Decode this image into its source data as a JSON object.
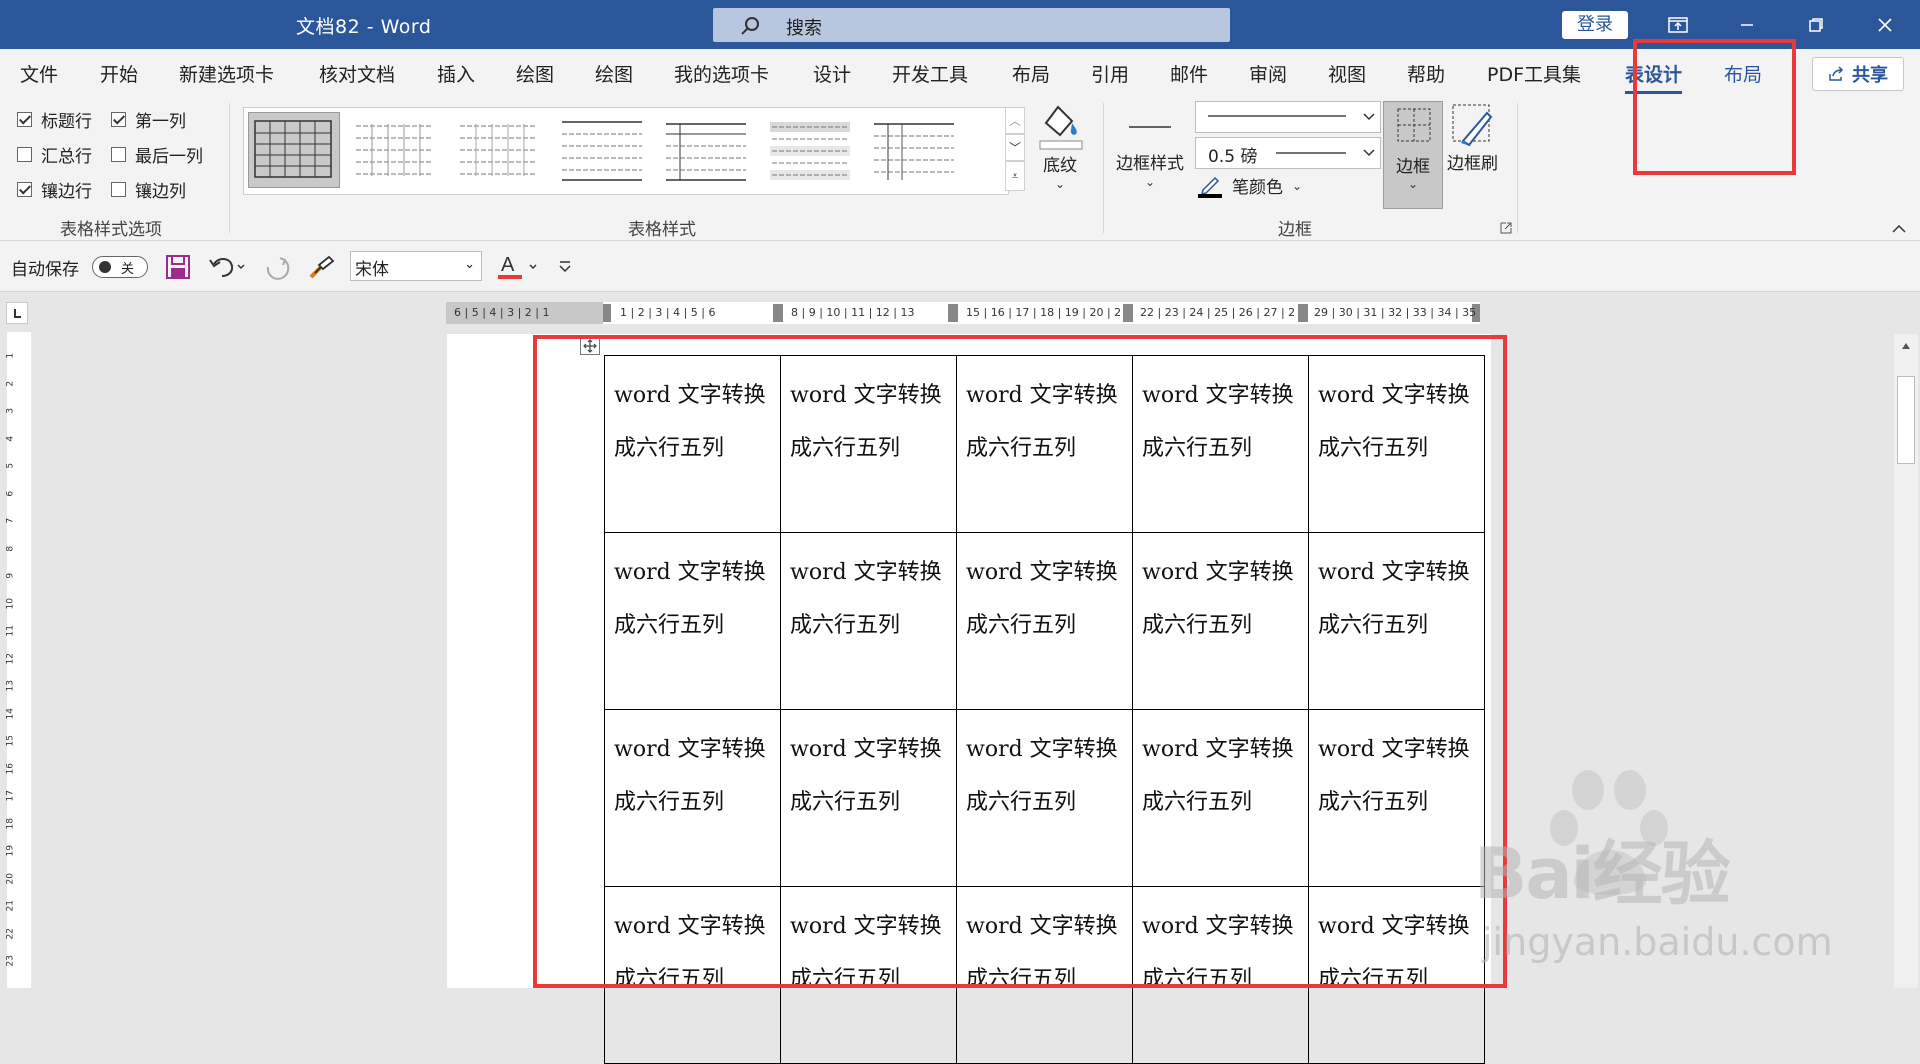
{
  "titlebar": {
    "doc_title": "文档82  -  Word",
    "search_label": "搜索",
    "login": "登录",
    "icons": [
      "ribbon-display-icon",
      "minimize-icon",
      "restore-icon",
      "close-icon"
    ]
  },
  "tabs": [
    {
      "label": "文件"
    },
    {
      "label": "开始"
    },
    {
      "label": "新建选项卡"
    },
    {
      "label": "核对文档"
    },
    {
      "label": "插入"
    },
    {
      "label": "绘图"
    },
    {
      "label": "绘图"
    },
    {
      "label": "我的选项卡"
    },
    {
      "label": "设计"
    },
    {
      "label": "开发工具"
    },
    {
      "label": "布局"
    },
    {
      "label": "引用"
    },
    {
      "label": "邮件"
    },
    {
      "label": "审阅"
    },
    {
      "label": "视图"
    },
    {
      "label": "帮助"
    },
    {
      "label": "PDF工具集"
    },
    {
      "label": "表设计"
    },
    {
      "label": "布局"
    }
  ],
  "share": "共享",
  "ribbon": {
    "style_options": [
      {
        "label": "标题行",
        "checked": true
      },
      {
        "label": "第一列",
        "checked": true
      },
      {
        "label": "汇总行",
        "checked": false
      },
      {
        "label": "最后一列",
        "checked": false
      },
      {
        "label": "镶边行",
        "checked": true
      },
      {
        "label": "镶边列",
        "checked": false
      }
    ],
    "style_options_group": "表格样式选项",
    "table_styles_group": "表格样式",
    "shading": "底纹",
    "border_styles": "边框样式",
    "pen_weight": "0.5 磅",
    "pen_color": "笔颜色",
    "borders": "边框",
    "border_painter": "边框刷",
    "borders_group": "边框"
  },
  "qat": {
    "autosave": "自动保存",
    "toggle_state": "关",
    "font": "宋体"
  },
  "ruler": {
    "h_left": "6 | 5 | 4 | 3 | 2 | 1",
    "h_seg1": "1 | 2 | 3 | 4 | 5 | 6",
    "h_seg2": "8 | 9 | 10 | 11 | 12 | 13",
    "h_seg3": "15 | 16 | 17 | 18 | 19 | 20 | 2",
    "h_seg4": "22 | 23 | 24 | 25 | 26 | 27 | 2",
    "h_seg5": "29 | 30 | 31 | 32 | 33 | 34 | 35",
    "v_labels": [
      "1",
      "2",
      "3",
      "4",
      "5",
      "6",
      "7",
      "8",
      "9",
      "10",
      "11",
      "12",
      "13",
      "14",
      "15",
      "16",
      "17",
      "18",
      "19",
      "20",
      "21",
      "22",
      "23"
    ]
  },
  "table": {
    "cell_line1": "word 文字转换",
    "cell_line2": "成六行五列"
  },
  "watermark": {
    "brand": "Bai经验",
    "url": "jingyan.baidu.com"
  }
}
